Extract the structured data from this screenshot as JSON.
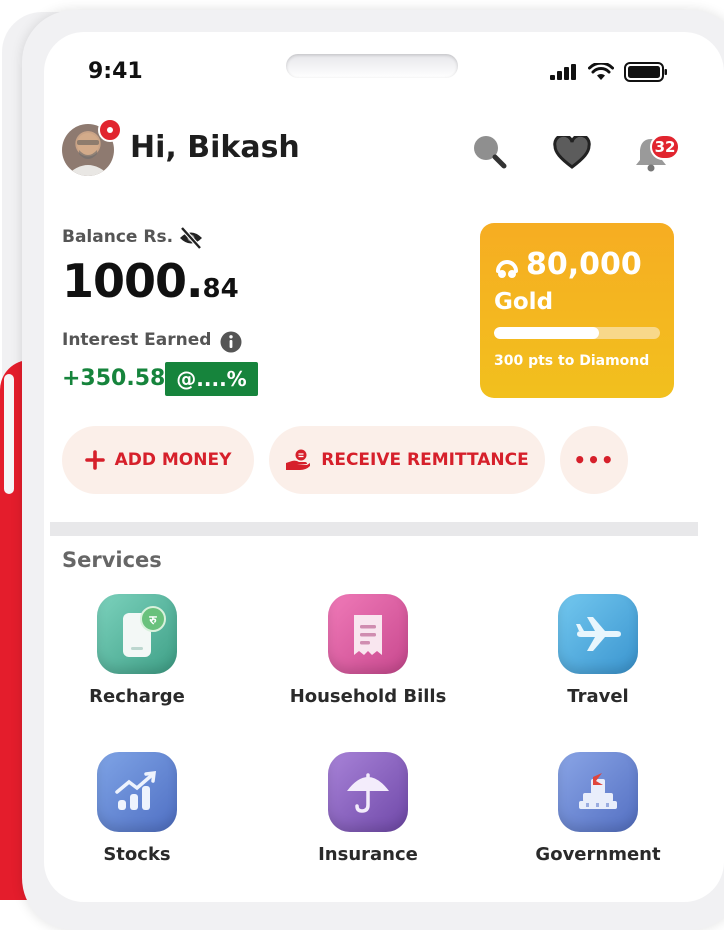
{
  "status_bar": {
    "time": "9:41"
  },
  "header": {
    "greeting": "Hi, Bikash",
    "notification_count": "32"
  },
  "balance": {
    "label": "Balance Rs.",
    "amount_main": "1000.",
    "amount_decimal": "84",
    "interest_label": "Interest Earned",
    "interest_value": "+350.58",
    "interest_rate": "@....%"
  },
  "rewards": {
    "points": "80,000",
    "tier": "Gold",
    "next_tier_text": "300 pts to  Diamond",
    "progress_fraction": 0.63
  },
  "actions": {
    "add_money": "ADD MONEY",
    "receive_remittance": "RECEIVE REMITTANCE",
    "more_label": "•••"
  },
  "services": {
    "title": "Services",
    "items": [
      {
        "label": "Recharge",
        "icon": "phone-recharge-icon"
      },
      {
        "label": "Household Bills",
        "icon": "bill-icon"
      },
      {
        "label": "Travel",
        "icon": "airplane-icon"
      },
      {
        "label": "Stocks",
        "icon": "stocks-chart-icon"
      },
      {
        "label": "Insurance",
        "icon": "umbrella-icon"
      },
      {
        "label": "Government",
        "icon": "government-building-icon"
      }
    ]
  },
  "colors": {
    "brand_red": "#e1252f",
    "interest_green": "#16843c",
    "gold_start": "#f6ad22",
    "gold_end": "#f2c01e",
    "pill_bg": "#fbefe9"
  }
}
